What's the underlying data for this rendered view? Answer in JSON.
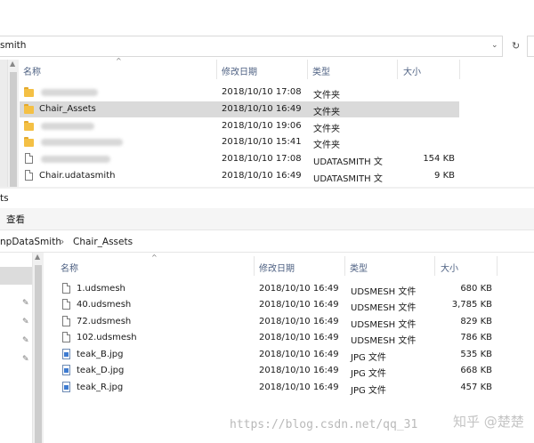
{
  "top_window": {
    "address": {
      "path": "smith"
    },
    "columns": {
      "name": "名称",
      "date": "修改日期",
      "type": "类型",
      "size": "大小"
    },
    "files": [
      {
        "name": "",
        "date": "2018/10/10 17:08",
        "type": "文件夹",
        "size": "",
        "icon": "folder-icon",
        "blurred": true
      },
      {
        "name": "Chair_Assets",
        "date": "2018/10/10 16:49",
        "type": "文件夹",
        "size": "",
        "icon": "folder-icon",
        "selected": true
      },
      {
        "name": "",
        "date": "2018/10/10 19:06",
        "type": "文件夹",
        "size": "",
        "icon": "folder-icon",
        "blurred": true
      },
      {
        "name": "",
        "date": "2018/10/10 15:41",
        "type": "文件夹",
        "size": "",
        "icon": "folder-icon",
        "blurred": true
      },
      {
        "name": "",
        "date": "2018/10/10 17:08",
        "type": "UDATASMITH 文",
        "size": "154 KB",
        "icon": "file-icon",
        "blurred": true
      },
      {
        "name": "Chair.udatasmith",
        "date": "2018/10/10 16:49",
        "type": "UDATASMITH 文",
        "size": "9 KB",
        "icon": "file-icon"
      }
    ]
  },
  "bottom_window": {
    "title": "ts",
    "ribbon": {
      "view_tab": "查看"
    },
    "breadcrumb": {
      "segment_1": "npDataSmith",
      "segment_2": "Chair_Assets",
      "separator": "›"
    },
    "columns": {
      "name": "名称",
      "date": "修改日期",
      "type": "类型",
      "size": "大小"
    },
    "files": [
      {
        "name": "1.udsmesh",
        "date": "2018/10/10 16:49",
        "type": "UDSMESH 文件",
        "size": "680 KB",
        "icon": "file-icon"
      },
      {
        "name": "40.udsmesh",
        "date": "2018/10/10 16:49",
        "type": "UDSMESH 文件",
        "size": "3,785 KB",
        "icon": "file-icon"
      },
      {
        "name": "72.udsmesh",
        "date": "2018/10/10 16:49",
        "type": "UDSMESH 文件",
        "size": "829 KB",
        "icon": "file-icon"
      },
      {
        "name": "102.udsmesh",
        "date": "2018/10/10 16:49",
        "type": "UDSMESH 文件",
        "size": "786 KB",
        "icon": "file-icon"
      },
      {
        "name": "teak_B.jpg",
        "date": "2018/10/10 16:49",
        "type": "JPG 文件",
        "size": "535 KB",
        "icon": "jpg-icon"
      },
      {
        "name": "teak_D.jpg",
        "date": "2018/10/10 16:49",
        "type": "JPG 文件",
        "size": "668 KB",
        "icon": "jpg-icon"
      },
      {
        "name": "teak_R.jpg",
        "date": "2018/10/10 16:49",
        "type": "JPG 文件",
        "size": "457 KB",
        "icon": "jpg-icon"
      }
    ]
  },
  "watermark": {
    "text": "https://blog.csdn.net/qq_31",
    "text2": "知乎 @楚楚"
  }
}
